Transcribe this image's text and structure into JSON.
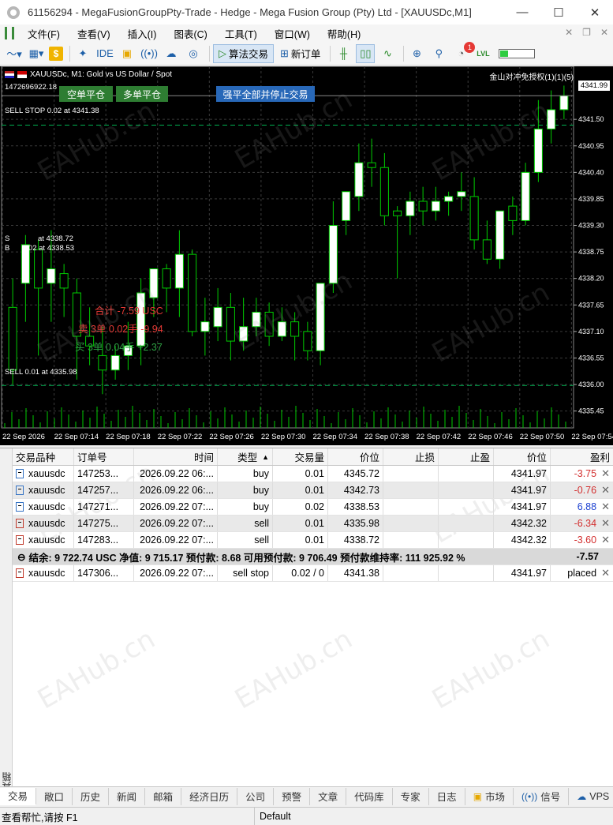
{
  "window": {
    "title": "61156294 - MegaFusionGroupPty-Trade - Hedge - Mega Fusion Group (Pty) Ltd - [XAUUSDc,M1]",
    "minimize": "—",
    "maximize": "☐",
    "close": "✕"
  },
  "menu": {
    "items": [
      "文件(F)",
      "查看(V)",
      "插入(I)",
      "图表(C)",
      "工具(T)",
      "窗口(W)",
      "帮助(H)"
    ],
    "right_icons": [
      "✕",
      "❐",
      "✕"
    ]
  },
  "toolbar": {
    "algo_trading": "算法交易",
    "new_order": "新订单",
    "ide": "IDE",
    "notification_count": "1",
    "lvl": "LVL",
    "dollar": "$"
  },
  "chart": {
    "symbol_info": "XAUUSDc, M1:  Gold vs US Dollar / Spot",
    "ticket_line": "1472696922.18",
    "btn_close_short": "空单平仓",
    "btn_close_long": "多单平仓",
    "btn_close_all": "强平全部并停止交易",
    "top_right": "金山对冲免授权(1)(1)(5)",
    "current_price": "4341.99",
    "sell_stop_label": "SELL STOP 0.02 at 4341.38",
    "sell_label_1": "SELL 0.01 at 4335.98",
    "s_label": "S",
    "s_label_2": "at 4338.72",
    "b_label": "B",
    "b_label_2": "0.02 at 4338.53",
    "sum_total": "合计  -7.59  USC",
    "sum_sell": "卖 3单 0.02手  -9.94",
    "sum_buy": "买 3单 0.04手  +2.37",
    "colors": {
      "background": "#000000",
      "up": "#ffffff",
      "down": "#000000",
      "wick": "#00cc00",
      "grid": "#3a3a3a"
    }
  },
  "chart_data": {
    "type": "candlestick",
    "symbol": "XAUUSDc",
    "timeframe": "M1",
    "y_ticks": [
      "4341.50",
      "4340.95",
      "4340.40",
      "4339.85",
      "4339.30",
      "4338.75",
      "4338.20",
      "4337.65",
      "4337.10",
      "4336.55",
      "4336.00",
      "4335.45"
    ],
    "x_ticks": [
      "22 Sep 2026",
      "22 Sep 07:14",
      "22 Sep 07:18",
      "22 Sep 07:22",
      "22 Sep 07:26",
      "22 Sep 07:30",
      "22 Sep 07:34",
      "22 Sep 07:38",
      "22 Sep 07:42",
      "22 Sep 07:46",
      "22 Sep 07:50",
      "22 Sep 07:54"
    ],
    "ylim": [
      4335.1,
      4342.6
    ],
    "candles": [
      {
        "o": 4337.6,
        "h": 4338.2,
        "c": 4336.3,
        "l": 4336.0
      },
      {
        "o": 4338.1,
        "h": 4339.1,
        "c": 4338.9,
        "l": 4337.3
      },
      {
        "o": 4338.8,
        "h": 4339.0,
        "c": 4338.0,
        "l": 4336.6
      },
      {
        "o": 4338.1,
        "h": 4339.2,
        "c": 4338.4,
        "l": 4337.3
      },
      {
        "o": 4338.3,
        "h": 4338.5,
        "c": 4338.0,
        "l": 4337.4
      },
      {
        "o": 4337.9,
        "h": 4338.2,
        "c": 4337.0,
        "l": 4336.1
      },
      {
        "o": 4337.0,
        "h": 4337.6,
        "c": 4336.8,
        "l": 4336.4
      },
      {
        "o": 4336.6,
        "h": 4337.2,
        "c": 4336.3,
        "l": 4335.8
      },
      {
        "o": 4336.3,
        "h": 4336.8,
        "c": 4336.6,
        "l": 4336.1
      },
      {
        "o": 4336.6,
        "h": 4337.3,
        "c": 4336.8,
        "l": 4336.3
      },
      {
        "o": 4336.8,
        "h": 4338.2,
        "c": 4337.9,
        "l": 4336.4
      },
      {
        "o": 4337.8,
        "h": 4338.4,
        "c": 4338.4,
        "l": 4337.4
      },
      {
        "o": 4338.4,
        "h": 4338.5,
        "c": 4338.0,
        "l": 4337.5
      },
      {
        "o": 4338.0,
        "h": 4339.2,
        "c": 4338.7,
        "l": 4337.4
      },
      {
        "o": 4338.7,
        "h": 4338.8,
        "c": 4337.1,
        "l": 4337.0
      },
      {
        "o": 4337.1,
        "h": 4337.8,
        "c": 4337.3,
        "l": 4336.6
      },
      {
        "o": 4337.2,
        "h": 4338.0,
        "c": 4337.6,
        "l": 4336.9
      },
      {
        "o": 4337.6,
        "h": 4337.9,
        "c": 4336.9,
        "l": 4336.5
      },
      {
        "o": 4336.9,
        "h": 4337.8,
        "c": 4337.2,
        "l": 4336.7
      },
      {
        "o": 4337.2,
        "h": 4337.8,
        "c": 4337.5,
        "l": 4337.0
      },
      {
        "o": 4337.5,
        "h": 4337.7,
        "c": 4337.0,
        "l": 4336.8
      },
      {
        "o": 4337.0,
        "h": 4337.6,
        "c": 4337.3,
        "l": 4336.9
      },
      {
        "o": 4337.3,
        "h": 4337.5,
        "c": 4337.0,
        "l": 4336.5
      },
      {
        "o": 4337.1,
        "h": 4337.3,
        "c": 4336.7,
        "l": 4336.5
      },
      {
        "o": 4336.7,
        "h": 4338.0,
        "c": 4338.1,
        "l": 4336.4
      },
      {
        "o": 4338.1,
        "h": 4339.8,
        "c": 4339.3,
        "l": 4337.9
      },
      {
        "o": 4339.4,
        "h": 4340.0,
        "c": 4340.0,
        "l": 4339.1
      },
      {
        "o": 4339.9,
        "h": 4341.0,
        "c": 4340.6,
        "l": 4339.6
      },
      {
        "o": 4340.6,
        "h": 4341.1,
        "c": 4340.5,
        "l": 4340.1
      },
      {
        "o": 4340.5,
        "h": 4340.8,
        "c": 4339.5,
        "l": 4339.3
      },
      {
        "o": 4339.6,
        "h": 4339.7,
        "c": 4339.5,
        "l": 4338.2
      },
      {
        "o": 4339.5,
        "h": 4340.0,
        "c": 4339.8,
        "l": 4339.1
      },
      {
        "o": 4339.8,
        "h": 4340.1,
        "c": 4339.6,
        "l": 4339.3
      },
      {
        "o": 4339.6,
        "h": 4340.1,
        "c": 4339.8,
        "l": 4339.4
      },
      {
        "o": 4339.8,
        "h": 4340.0,
        "c": 4339.9,
        "l": 4339.5
      },
      {
        "o": 4339.9,
        "h": 4340.4,
        "c": 4340.0,
        "l": 4339.6
      },
      {
        "o": 4339.9,
        "h": 4340.3,
        "c": 4339.0,
        "l": 4338.8
      },
      {
        "o": 4339.0,
        "h": 4339.4,
        "c": 4338.6,
        "l": 4338.5
      },
      {
        "o": 4338.6,
        "h": 4339.6,
        "c": 4339.6,
        "l": 4338.4
      },
      {
        "o": 4339.7,
        "h": 4339.9,
        "c": 4339.4,
        "l": 4339.1
      },
      {
        "o": 4339.4,
        "h": 4340.6,
        "c": 4340.4,
        "l": 4339.3
      },
      {
        "o": 4340.4,
        "h": 4341.9,
        "c": 4341.3,
        "l": 4340.2
      },
      {
        "o": 4341.3,
        "h": 4342.1,
        "c": 4341.7,
        "l": 4341.0
      },
      {
        "o": 4341.7,
        "h": 4342.2,
        "c": 4341.99,
        "l": 4341.5
      }
    ],
    "horizontal_lines": [
      {
        "label": "SELL STOP 0.02 at 4341.38",
        "value": 4341.38,
        "style": "dashed",
        "color": "#00b050"
      },
      {
        "label": "SELL 0.01 at 4335.98",
        "value": 4335.98,
        "style": "dashed",
        "color": "#00b050"
      }
    ],
    "current_price": 4341.99
  },
  "table": {
    "headers": [
      "交易品种",
      "订单号",
      "时间",
      "类型",
      "交易量",
      "价位",
      "止损",
      "止盈",
      "价位",
      "盈利"
    ],
    "sort_indicator": "▲",
    "rows": [
      {
        "symbol": "xauusdc",
        "ticket": "147253...",
        "time": "2026.09.22 06:...",
        "type": "buy",
        "volume": "0.01",
        "price": "4345.72",
        "sl": "",
        "tp": "",
        "cur": "4341.97",
        "profit": "-3.75",
        "sign": "neg",
        "kind": "buy"
      },
      {
        "symbol": "xauusdc",
        "ticket": "147257...",
        "time": "2026.09.22 06:...",
        "type": "buy",
        "volume": "0.01",
        "price": "4342.73",
        "sl": "",
        "tp": "",
        "cur": "4341.97",
        "profit": "-0.76",
        "sign": "neg",
        "kind": "buy"
      },
      {
        "symbol": "xauusdc",
        "ticket": "147271...",
        "time": "2026.09.22 07:...",
        "type": "buy",
        "volume": "0.02",
        "price": "4338.53",
        "sl": "",
        "tp": "",
        "cur": "4341.97",
        "profit": "6.88",
        "sign": "pos",
        "kind": "buy"
      },
      {
        "symbol": "xauusdc",
        "ticket": "147275...",
        "time": "2026.09.22 07:...",
        "type": "sell",
        "volume": "0.01",
        "price": "4335.98",
        "sl": "",
        "tp": "",
        "cur": "4342.32",
        "profit": "-6.34",
        "sign": "neg",
        "kind": "sell"
      },
      {
        "symbol": "xauusdc",
        "ticket": "147283...",
        "time": "2026.09.22 07:...",
        "type": "sell",
        "volume": "0.01",
        "price": "4338.72",
        "sl": "",
        "tp": "",
        "cur": "4342.32",
        "profit": "-3.60",
        "sign": "neg",
        "kind": "sell"
      }
    ],
    "summary": {
      "icon": "⊖",
      "text": "结余: 9 722.74 USC  净值: 9 715.17  预付款: 8.68  可用预付款: 9 706.49  预付款维持率: 111 925.92 %",
      "total": "-7.57"
    },
    "pending": {
      "symbol": "xauusdc",
      "ticket": "147306...",
      "time": "2026.09.22 07:...",
      "type": "sell stop",
      "volume": "0.02 / 0",
      "price": "4341.38",
      "sl": "",
      "tp": "",
      "cur": "4341.97",
      "profit": "placed"
    }
  },
  "bottom_tabs": [
    "交易",
    "敞口",
    "历史",
    "新闻",
    "邮箱",
    "经济日历",
    "公司",
    "预警",
    "文章",
    "代码库",
    "专家",
    "日志",
    "市场",
    "信号",
    "VPS"
  ],
  "side_label": "工具箱",
  "status": {
    "help": "查看帮忙,请按 F1",
    "profile": "Default"
  },
  "watermark": "EAHub.cn"
}
